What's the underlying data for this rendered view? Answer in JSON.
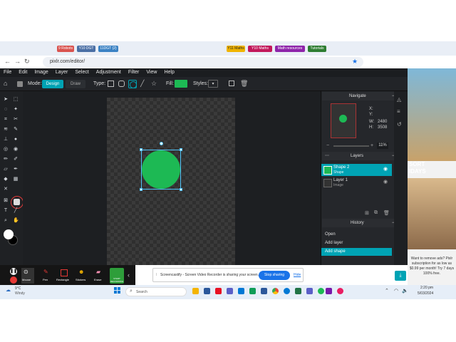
{
  "browser": {
    "url": "pixlr.com/editor/",
    "bookmarks": [
      "9 Robots",
      "Y10 DGT",
      "11DGT (2)",
      "Y11 Maths",
      "Y10 Maths",
      "Math resources",
      "Tutorials"
    ]
  },
  "menu": [
    "File",
    "Edit",
    "Image",
    "Layer",
    "Select",
    "Adjustment",
    "Filter",
    "View",
    "Help"
  ],
  "toolbar": {
    "mode_label": "Mode:",
    "mode_design": "Design",
    "mode_draw": "Draw",
    "type_label": "Type:",
    "fill_label": "Fill:",
    "styles_label": "Styles:"
  },
  "navigator": {
    "title": "Navigate",
    "x_label": "X:",
    "y_label": "Y:",
    "w_label": "W:",
    "h_label": "H:",
    "w_value": "2480",
    "h_value": "3508",
    "zoom": "11%"
  },
  "layers": {
    "title": "Layers",
    "items": [
      {
        "name": "Shape 2",
        "type": "Shape"
      },
      {
        "name": "Layer 1",
        "type": "Image"
      }
    ]
  },
  "history": {
    "title": "History",
    "items": [
      "Open",
      "Add layer",
      "Add shape"
    ]
  },
  "recorder": {
    "tools": [
      "Mouse",
      "Pen",
      "Rectangle",
      "Stickers",
      "Erase"
    ],
    "start_label": "START RECORDING",
    "notice": "Screencastify - Screen Video Recorder is sharing your screen.",
    "stop_label": "Stop sharing",
    "hide_label": "Hide"
  },
  "ad": {
    "text1": "SORT",
    "text2": "IDAYS",
    "copy": "Want to remove ads? Pixlr subscription for as low as $0.99 per month! Try 7 days 100% free."
  },
  "taskbar": {
    "weather_temp": "9°C",
    "weather_desc": "Windy",
    "search_placeholder": "Search",
    "time": "2:20 pm",
    "date": "5/03/2024"
  },
  "colors": {
    "accent": "#00a3b4",
    "shape_fill": "#1db954"
  }
}
